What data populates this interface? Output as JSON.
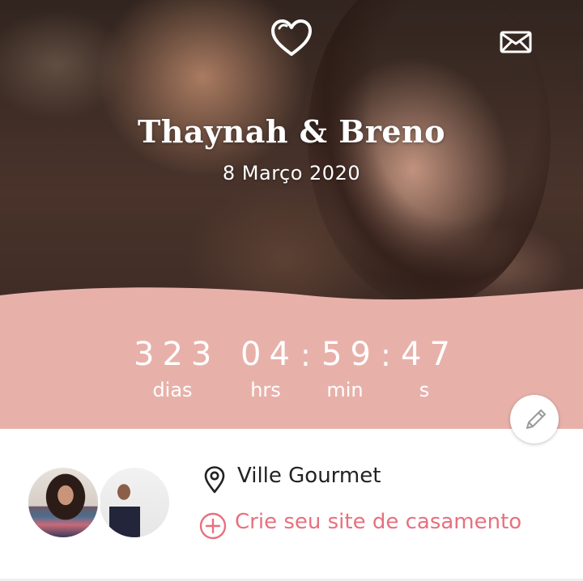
{
  "header": {
    "couple_names": "Thaynah & Breno",
    "date": "8 Março 2020",
    "icons": {
      "left": "heart-icon",
      "right": "mail-icon"
    }
  },
  "countdown": {
    "days": "323",
    "hours": "04",
    "minutes": "59",
    "seconds": "47",
    "separator": ":",
    "labels": {
      "days": "dias",
      "hours": "hrs",
      "minutes": "min",
      "seconds": "s"
    }
  },
  "edit_icon": "pencil-icon",
  "info": {
    "venue": "Ville Gourmet",
    "create_site": "Crie seu site de casamento"
  },
  "colors": {
    "band": "#e7b1aa",
    "accent": "#e8707e",
    "text": "#222222",
    "white": "#ffffff"
  }
}
